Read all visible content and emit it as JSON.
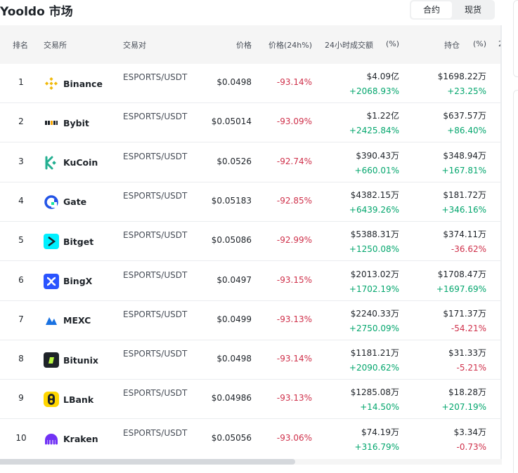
{
  "header": {
    "title": "Yooldo 市场"
  },
  "toggle": {
    "options": [
      "合约",
      "现货"
    ]
  },
  "table": {
    "columns": {
      "rank": "排名",
      "exchange": "交易所",
      "pair": "交易对",
      "price": "价格",
      "change": "价格(24h%)",
      "volume": "24小时成交额",
      "volume_pct": "(%)",
      "oi": "持仓",
      "oi_pct": "(%)",
      "extra": "2"
    },
    "rows": [
      {
        "rank": "1",
        "exchange": "Binance",
        "icon": "binance-icon",
        "pair": "ESPORTS/USDT",
        "price": "$0.0498",
        "change": "-93.14%",
        "volume": "$4.09亿",
        "volume_pct": "+2068.93%",
        "oi": "$1698.22万",
        "oi_pct": "+23.25%"
      },
      {
        "rank": "2",
        "exchange": "Bybit",
        "icon": "bybit-icon",
        "pair": "ESPORTS/USDT",
        "price": "$0.05014",
        "change": "-93.09%",
        "volume": "$1.22亿",
        "volume_pct": "+2425.84%",
        "oi": "$637.57万",
        "oi_pct": "+86.40%"
      },
      {
        "rank": "3",
        "exchange": "KuCoin",
        "icon": "kucoin-icon",
        "pair": "ESPORTS/USDT",
        "price": "$0.0526",
        "change": "-92.74%",
        "volume": "$390.43万",
        "volume_pct": "+660.01%",
        "oi": "$348.94万",
        "oi_pct": "+167.81%"
      },
      {
        "rank": "4",
        "exchange": "Gate",
        "icon": "gate-icon",
        "pair": "ESPORTS/USDT",
        "price": "$0.05183",
        "change": "-92.85%",
        "volume": "$4382.15万",
        "volume_pct": "+6439.26%",
        "oi": "$181.72万",
        "oi_pct": "+346.16%"
      },
      {
        "rank": "5",
        "exchange": "Bitget",
        "icon": "bitget-icon",
        "pair": "ESPORTS/USDT",
        "price": "$0.05086",
        "change": "-92.99%",
        "volume": "$5388.31万",
        "volume_pct": "+1250.08%",
        "oi": "$374.11万",
        "oi_pct": "-36.62%"
      },
      {
        "rank": "6",
        "exchange": "BingX",
        "icon": "bingx-icon",
        "pair": "ESPORTS/USDT",
        "price": "$0.0497",
        "change": "-93.15%",
        "volume": "$2013.02万",
        "volume_pct": "+1702.19%",
        "oi": "$1708.47万",
        "oi_pct": "+1697.69%"
      },
      {
        "rank": "7",
        "exchange": "MEXC",
        "icon": "mexc-icon",
        "pair": "ESPORTS/USDT",
        "price": "$0.0499",
        "change": "-93.13%",
        "volume": "$2240.33万",
        "volume_pct": "+2750.09%",
        "oi": "$171.37万",
        "oi_pct": "-54.21%"
      },
      {
        "rank": "8",
        "exchange": "Bitunix",
        "icon": "bitunix-icon",
        "pair": "ESPORTS/USDT",
        "price": "$0.0498",
        "change": "-93.14%",
        "volume": "$1181.21万",
        "volume_pct": "+2090.62%",
        "oi": "$31.33万",
        "oi_pct": "-5.21%"
      },
      {
        "rank": "9",
        "exchange": "LBank",
        "icon": "lbank-icon",
        "pair": "ESPORTS/USDT",
        "price": "$0.04986",
        "change": "-93.13%",
        "volume": "$1285.08万",
        "volume_pct": "+14.50%",
        "oi": "$18.28万",
        "oi_pct": "+207.19%"
      },
      {
        "rank": "10",
        "exchange": "Kraken",
        "icon": "kraken-icon",
        "pair": "ESPORTS/USDT",
        "price": "$0.05056",
        "change": "-93.06%",
        "volume": "$74.19万",
        "volume_pct": "+316.79%",
        "oi": "$3.34万",
        "oi_pct": "-0.73%"
      }
    ]
  },
  "colors": {
    "positive": "#03a66d",
    "negative": "#cf304a",
    "header_bg": "#f5f5f5"
  }
}
